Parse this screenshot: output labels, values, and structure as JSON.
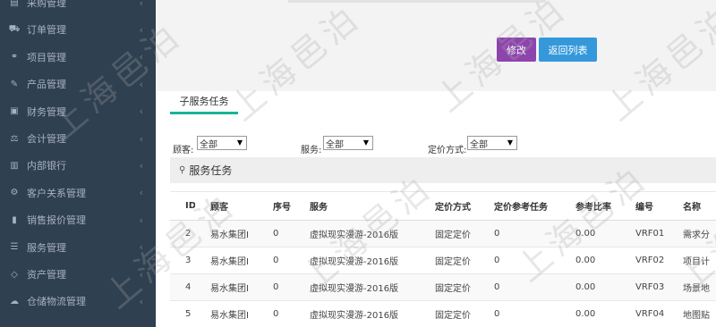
{
  "sidebar": {
    "items": [
      {
        "icon": "cart-icon",
        "glyph": "▤",
        "label": "采购管理"
      },
      {
        "icon": "order-icon",
        "glyph": "⛟",
        "label": "订单管理"
      },
      {
        "icon": "project-icon",
        "glyph": "⚭",
        "label": "项目管理"
      },
      {
        "icon": "product-icon",
        "glyph": "✎",
        "label": "产品管理"
      },
      {
        "icon": "finance-icon",
        "glyph": "▣",
        "label": "财务管理"
      },
      {
        "icon": "accounting-icon",
        "glyph": "⚖",
        "label": "会计管理"
      },
      {
        "icon": "bank-icon",
        "glyph": "▥",
        "label": "内部银行"
      },
      {
        "icon": "crm-icon",
        "glyph": "⚙",
        "label": "客户关系管理"
      },
      {
        "icon": "sales-quote-icon",
        "glyph": "▮",
        "label": "销售报价管理"
      },
      {
        "icon": "service-icon",
        "glyph": "☰",
        "label": "服务管理"
      },
      {
        "icon": "asset-icon",
        "glyph": "◇",
        "label": "资产管理"
      },
      {
        "icon": "warehouse-icon",
        "glyph": "☁",
        "label": "仓储物流管理"
      }
    ],
    "chevron": "‹"
  },
  "toolbar": {
    "edit_label": "修改",
    "back_label": "返回列表"
  },
  "tab": {
    "label": "子服务任务"
  },
  "filters": {
    "customer_label": "顾客:",
    "customer_value": "全部",
    "service_label": "服务:",
    "service_value": "全部",
    "pricing_label": "定价方式:",
    "pricing_value": "全部",
    "arrow": "▼"
  },
  "section": {
    "icon": "user-icon",
    "glyph": "⚲",
    "title": "服务任务"
  },
  "table": {
    "columns": [
      "ID",
      "顾客",
      "序号",
      "服务",
      "定价方式",
      "定价参考任务",
      "参考比率",
      "编号",
      "名称"
    ],
    "rows": [
      [
        "2",
        "易水集团I",
        "0",
        "虚拟现实漫游-2016版",
        "固定定价",
        "0",
        "0.00",
        "VRF01",
        "需求分"
      ],
      [
        "3",
        "易水集团I",
        "0",
        "虚拟现实漫游-2016版",
        "固定定价",
        "0",
        "0.00",
        "VRF02",
        "项目计"
      ],
      [
        "4",
        "易水集团I",
        "0",
        "虚拟现实漫游-2016版",
        "固定定价",
        "0",
        "0.00",
        "VRF03",
        "场景地"
      ],
      [
        "5",
        "易水集团I",
        "0",
        "虚拟现实漫游-2016版",
        "固定定价",
        "0",
        "0.00",
        "VRF04",
        "地图贴"
      ]
    ]
  },
  "watermark": "上海邑泊"
}
